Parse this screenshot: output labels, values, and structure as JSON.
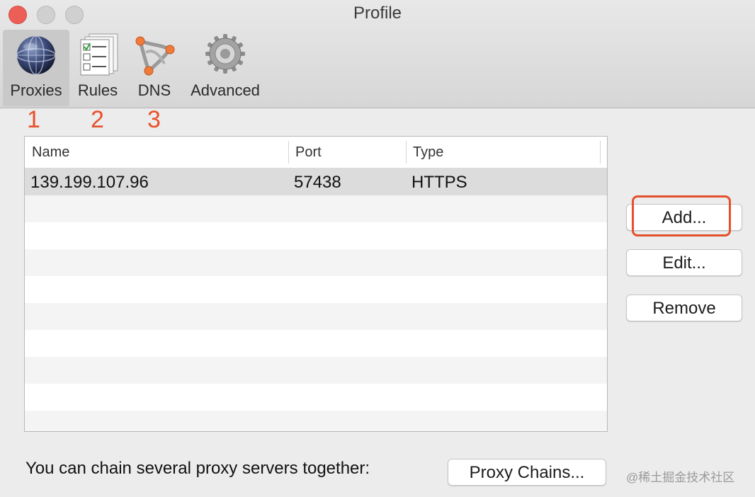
{
  "window": {
    "title": "Profile"
  },
  "toolbar": {
    "items": [
      {
        "label": "Proxies",
        "icon": "globe-icon",
        "active": true
      },
      {
        "label": "Rules",
        "icon": "checklist-icon",
        "active": false
      },
      {
        "label": "DNS",
        "icon": "dns-network-icon",
        "active": false
      },
      {
        "label": "Advanced",
        "icon": "gear-icon",
        "active": false
      }
    ]
  },
  "annotations": {
    "numbers": [
      "1",
      "2",
      "3"
    ],
    "color": "#e8512a",
    "highlight_color": "#e4502c"
  },
  "table": {
    "columns": [
      "Name",
      "Port",
      "Type"
    ],
    "rows": [
      {
        "name": "139.199.107.96",
        "port": "57438",
        "type": "HTTPS"
      }
    ]
  },
  "buttons": {
    "add": "Add...",
    "edit": "Edit...",
    "remove": "Remove",
    "proxy_chains": "Proxy Chains..."
  },
  "footer": {
    "text": "You can chain several proxy servers together:"
  },
  "watermark": "@稀土掘金技术社区"
}
